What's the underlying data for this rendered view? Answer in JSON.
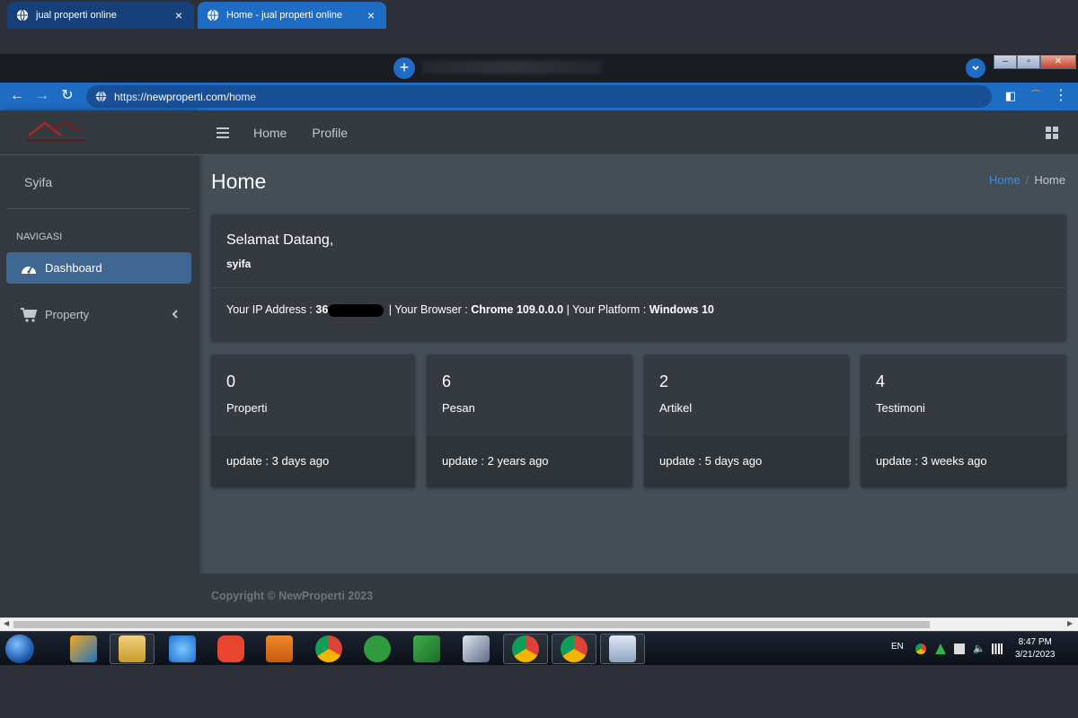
{
  "browser": {
    "tabs": [
      {
        "title": "jual properti online"
      },
      {
        "title": "Home - jual properti online"
      }
    ],
    "url_prefix": "https://",
    "url_host": "newproperti.com",
    "url_path": "/home"
  },
  "sidebar": {
    "user_name": "Syifa",
    "nav_header": "NAVIGASI",
    "items": [
      {
        "label": "Dashboard",
        "icon": "tachometer-icon",
        "active": true
      },
      {
        "label": "Property",
        "icon": "cart-icon",
        "active": false
      }
    ]
  },
  "topnav": {
    "links": [
      "Home",
      "Profile"
    ]
  },
  "page": {
    "title": "Home",
    "breadcrumb": {
      "link": "Home",
      "separator": "/",
      "current": "Home"
    }
  },
  "welcome": {
    "title": "Selamat Datang,",
    "user": "syifa",
    "ip_label": "Your IP Address : ",
    "ip_value": "36",
    "ip_tail": "",
    "browser_label": " | Your Browser : ",
    "browser_value": "Chrome 109.0.0.0",
    "platform_label": " | Your Platform : ",
    "platform_value": "Windows 10"
  },
  "stats": [
    {
      "value": "0",
      "label": "Properti",
      "update": "update : 3 days ago"
    },
    {
      "value": "6",
      "label": "Pesan",
      "update": "update : 2 years ago"
    },
    {
      "value": "2",
      "label": "Artikel",
      "update": "update : 5 days ago"
    },
    {
      "value": "4",
      "label": "Testimoni",
      "update": "update : 3 weeks ago"
    }
  ],
  "footer": {
    "copyright": "Copyright © NewProperti 2023"
  },
  "taskbar": {
    "lang": "EN",
    "time": "8:47 PM",
    "date": "3/21/2023"
  },
  "colors": {
    "sidebar_bg": "#343a40",
    "content_bg": "#454d55",
    "active_nav": "#3f6791",
    "browser_blue": "#1f6cc4",
    "breadcrumb_link": "#3f8cde"
  }
}
